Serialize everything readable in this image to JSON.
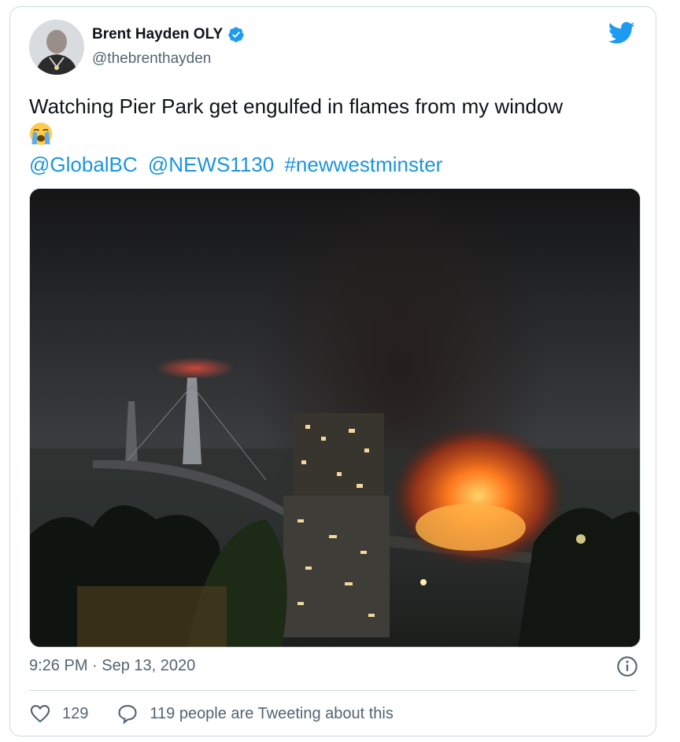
{
  "author": {
    "display_name": "Brent Hayden OLY",
    "handle": "@thebrenthayden",
    "verified": true
  },
  "tweet": {
    "text": "Watching Pier Park get engulfed in flames from my window",
    "emoji_icon": "loudly-crying-face-icon",
    "mentions": [
      "@GlobalBC",
      "@NEWS1130",
      "#newwestminster"
    ],
    "timestamp": "9:26 PM · Sep 13, 2020"
  },
  "stats": {
    "likes": "129",
    "reply_text": "119 people are Tweeting about this"
  },
  "icons": {
    "platform": "twitter-bird-icon",
    "verified": "verified-badge-icon",
    "info": "info-icon",
    "like": "heart-icon",
    "reply": "speech-bubble-icon"
  },
  "colors": {
    "link": "#1b95e0",
    "verified": "#1d9bf0",
    "secondary_text": "#536471",
    "border": "#cfd9de"
  }
}
